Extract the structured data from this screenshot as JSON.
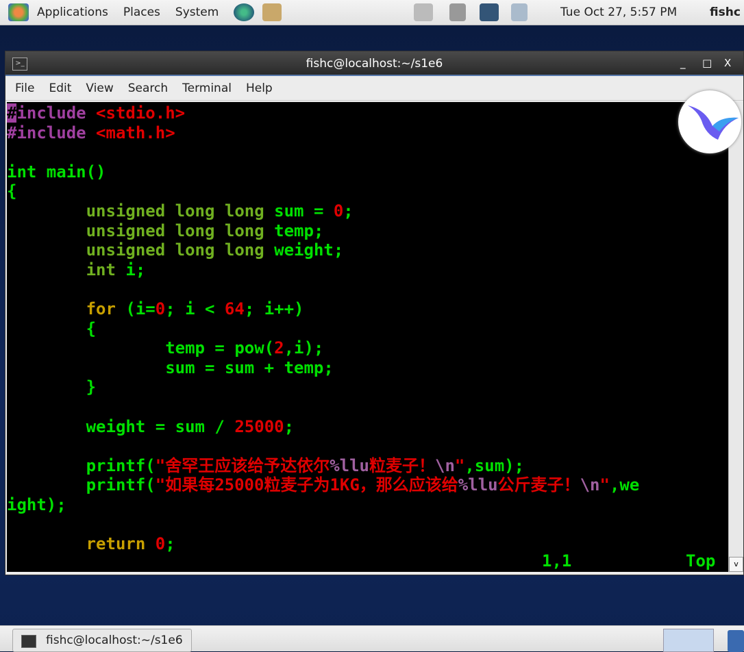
{
  "top_panel": {
    "menus": [
      "Applications",
      "Places",
      "System"
    ],
    "clock": "Tue Oct 27,  5:57 PM",
    "user": "fishc",
    "icons": [
      "gnome-foot-icon",
      "web-browser-icon",
      "mail-icon",
      "network-icon",
      "volume-icon",
      "network-disconnected-icon",
      "battery-power-icon"
    ]
  },
  "window": {
    "title": "fishc@localhost:~/s1e6",
    "menu": [
      "File",
      "Edit",
      "View",
      "Search",
      "Terminal",
      "Help"
    ],
    "controls": {
      "minimize": "_",
      "maximize": "□",
      "close": "X"
    }
  },
  "colors": {
    "preproc": "#a040a0",
    "string": "#e00000",
    "type": "#70b020",
    "identifier": "#00e000",
    "keyword": "#c8a000",
    "background": "#000000"
  },
  "code": [
    [
      [
        "cur",
        "#"
      ],
      [
        "pp",
        "include "
      ],
      [
        "st",
        "<stdio.h>"
      ]
    ],
    [
      [
        "pp",
        "#include "
      ],
      [
        "st",
        "<math.h>"
      ]
    ],
    [],
    [
      [
        "id",
        "int main()"
      ]
    ],
    [
      [
        "id",
        "{"
      ]
    ],
    [
      [
        "id",
        "        "
      ],
      [
        "ty",
        "unsigned long long "
      ],
      [
        "id",
        "sum = "
      ],
      [
        "nu",
        "0"
      ],
      [
        "id",
        ";"
      ]
    ],
    [
      [
        "id",
        "        "
      ],
      [
        "ty",
        "unsigned long long "
      ],
      [
        "id",
        "temp;"
      ]
    ],
    [
      [
        "id",
        "        "
      ],
      [
        "ty",
        "unsigned long long "
      ],
      [
        "id",
        "weight;"
      ]
    ],
    [
      [
        "id",
        "        "
      ],
      [
        "ty",
        "int "
      ],
      [
        "id",
        "i;"
      ]
    ],
    [],
    [
      [
        "id",
        "        "
      ],
      [
        "kw",
        "for"
      ],
      [
        "id",
        " (i="
      ],
      [
        "nu",
        "0"
      ],
      [
        "id",
        "; i < "
      ],
      [
        "nu",
        "64"
      ],
      [
        "id",
        "; i++)"
      ]
    ],
    [
      [
        "id",
        "        {"
      ]
    ],
    [
      [
        "id",
        "                temp = pow("
      ],
      [
        "nu",
        "2"
      ],
      [
        "id",
        ",i);"
      ]
    ],
    [
      [
        "id",
        "                sum = sum + temp;"
      ]
    ],
    [
      [
        "id",
        "        }"
      ]
    ],
    [],
    [
      [
        "id",
        "        weight = sum / "
      ],
      [
        "nu",
        "25000"
      ],
      [
        "id",
        ";"
      ]
    ],
    [],
    [
      [
        "id",
        "        printf("
      ],
      [
        "st",
        "\"舍罕王应该给予达依尔"
      ],
      [
        "fm",
        "%llu"
      ],
      [
        "st",
        "粒麦子！"
      ],
      [
        "fm",
        "\\n"
      ],
      [
        "st",
        "\""
      ],
      [
        "id",
        ",sum);"
      ]
    ],
    [
      [
        "id",
        "        printf("
      ],
      [
        "st",
        "\"如果每25000粒麦子为1KG，那么应该给"
      ],
      [
        "fm",
        "%llu"
      ],
      [
        "st",
        "公斤麦子！"
      ],
      [
        "fm",
        "\\n"
      ],
      [
        "st",
        "\""
      ],
      [
        "id",
        ",we"
      ]
    ],
    [
      [
        "id",
        "ight);"
      ]
    ],
    [],
    [
      [
        "id",
        "        "
      ],
      [
        "kw",
        "return "
      ],
      [
        "nu",
        "0"
      ],
      [
        "id",
        ";"
      ]
    ]
  ],
  "status": {
    "position": "1,1",
    "scroll": "Top"
  },
  "taskbar": {
    "task_label": "fishc@localhost:~/s1e6"
  }
}
